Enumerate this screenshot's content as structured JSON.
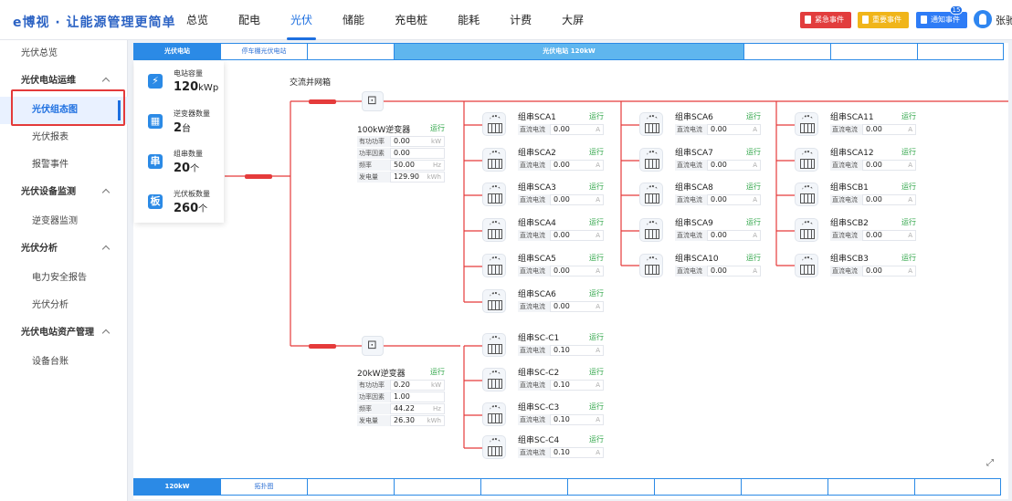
{
  "header": {
    "logo": "e博视 · 让能源管理更简单",
    "nav": [
      "总览",
      "配电",
      "光伏",
      "储能",
      "充电桩",
      "能耗",
      "计费",
      "大屏"
    ],
    "active_nav": "光伏",
    "alerts": {
      "urgent": "紧急事件",
      "important": "重要事件",
      "notice": "通知事件",
      "notice_count": "15"
    },
    "user": "张驰",
    "colors": {
      "urgent": "#e23d3d",
      "important": "#f0b51a",
      "notice": "#2e7cf6"
    }
  },
  "sidebar": {
    "overview": "光伏总览",
    "groups": [
      {
        "label": "光伏电站运维",
        "items": [
          "光伏组态图",
          "光伏报表",
          "报警事件"
        ]
      },
      {
        "label": "光伏设备监测",
        "items": [
          "逆变器监测"
        ]
      },
      {
        "label": "光伏分析",
        "items": [
          "电力安全报告",
          "光伏分析"
        ]
      },
      {
        "label": "光伏电站资产管理",
        "items": [
          "设备台账"
        ]
      }
    ],
    "active": "光伏组态图"
  },
  "tabs_top": [
    "光伏电站",
    "停车棚光伏电站",
    "",
    "光伏电站 120kW",
    "",
    "",
    ""
  ],
  "tabs_bottom": [
    "120kW",
    "拓扑图",
    "",
    "",
    "",
    "",
    "",
    "",
    "",
    ""
  ],
  "stats": [
    {
      "icon": "station-icon",
      "label": "电站容量",
      "value": "120",
      "unit": "kWp"
    },
    {
      "icon": "inverter-icon",
      "label": "逆变器数量",
      "value": "2",
      "unit": "台"
    },
    {
      "icon": "string-icon",
      "glyph": "串",
      "label": "组串数量",
      "value": "20",
      "unit": "个"
    },
    {
      "icon": "panel-icon",
      "glyph": "板",
      "label": "光伏板数量",
      "value": "260",
      "unit": "个"
    }
  ],
  "combiner_label": "交流并网箱",
  "inverters": [
    {
      "name": "100kW逆变器",
      "status": "运行",
      "rows": [
        {
          "k": "有功功率",
          "v": "0.00",
          "u": "kW"
        },
        {
          "k": "功率因素",
          "v": "0.00",
          "u": ""
        },
        {
          "k": "频率",
          "v": "50.00",
          "u": "Hz"
        },
        {
          "k": "发电量",
          "v": "129.90",
          "u": "kWh"
        }
      ]
    },
    {
      "name": "20kW逆变器",
      "status": "运行",
      "rows": [
        {
          "k": "有功功率",
          "v": "0.20",
          "u": "kW"
        },
        {
          "k": "功率因素",
          "v": "1.00",
          "u": ""
        },
        {
          "k": "频率",
          "v": "44.22",
          "u": "Hz"
        },
        {
          "k": "发电量",
          "v": "26.30",
          "u": "kWh"
        }
      ]
    }
  ],
  "string_field": {
    "label": "直流电流",
    "unit": "A",
    "status": "运行"
  },
  "strings_inv1": {
    "columns": [
      [
        {
          "name": "组串SCA1",
          "value": "0.00"
        },
        {
          "name": "组串SCA2",
          "value": "0.00"
        },
        {
          "name": "组串SCA3",
          "value": "0.00"
        },
        {
          "name": "组串SCA4",
          "value": "0.00"
        },
        {
          "name": "组串SCA5",
          "value": "0.00"
        },
        {
          "name": "组串SCA6",
          "value": "0.00"
        }
      ],
      [
        {
          "name": "组串SCA6",
          "value": "0.00"
        },
        {
          "name": "组串SCA7",
          "value": "0.00"
        },
        {
          "name": "组串SCA8",
          "value": "0.00"
        },
        {
          "name": "组串SCA9",
          "value": "0.00"
        },
        {
          "name": "组串SCA10",
          "value": "0.00"
        }
      ],
      [
        {
          "name": "组串SCA11",
          "value": "0.00"
        },
        {
          "name": "组串SCA12",
          "value": "0.00"
        },
        {
          "name": "组串SCB1",
          "value": "0.00"
        },
        {
          "name": "组串SCB2",
          "value": "0.00"
        },
        {
          "name": "组串SCB3",
          "value": "0.00"
        }
      ]
    ]
  },
  "strings_inv2": [
    {
      "name": "组串SC-C1",
      "value": "0.10"
    },
    {
      "name": "组串SC-C2",
      "value": "0.10"
    },
    {
      "name": "组串SC-C3",
      "value": "0.10"
    },
    {
      "name": "组串SC-C4",
      "value": "0.10"
    }
  ],
  "line_color": "#e53b3b"
}
